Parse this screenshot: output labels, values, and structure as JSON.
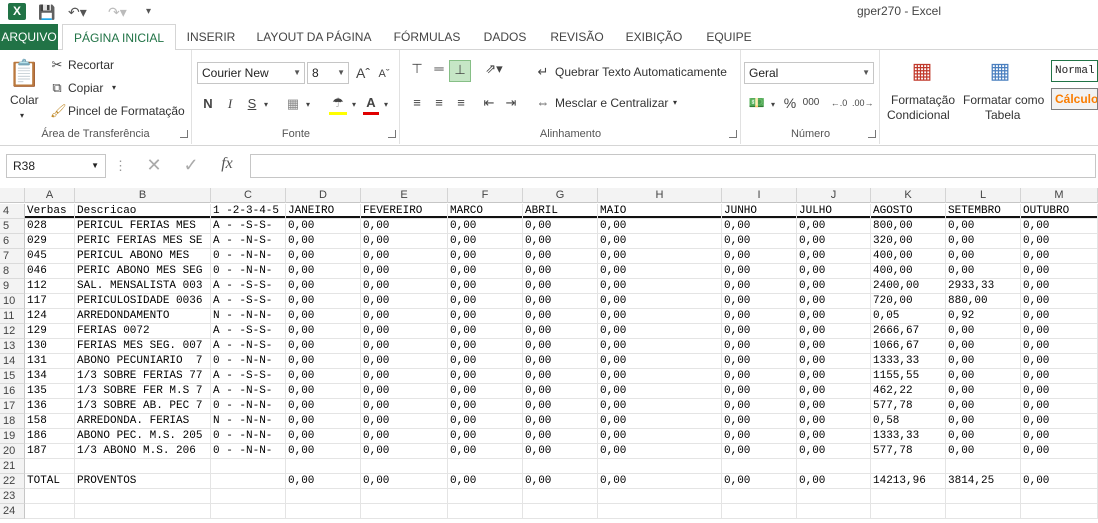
{
  "app": {
    "window_title": "gper270 - Excel"
  },
  "tabs": {
    "file": "ARQUIVO",
    "home": "PÁGINA INICIAL",
    "insert": "INSERIR",
    "layout": "LAYOUT DA PÁGINA",
    "formulas": "FÓRMULAS",
    "data": "DADOS",
    "review": "REVISÃO",
    "view": "EXIBIÇÃO",
    "team": "EQUIPE"
  },
  "ribbon": {
    "clipboard": {
      "label": "Área de Transferência",
      "paste": "Colar",
      "cut": "Recortar",
      "copy": "Copiar",
      "painter": "Pincel de Formatação"
    },
    "font": {
      "label": "Fonte",
      "family": "Courier New",
      "size": "8",
      "bold": "N",
      "italic": "I",
      "underline": "S"
    },
    "alignment": {
      "label": "Alinhamento",
      "wrap": "Quebrar Texto Automaticamente",
      "merge": "Mesclar e Centralizar"
    },
    "number": {
      "label": "Número",
      "format": "Geral",
      "percent": "%",
      "thousands": "000"
    },
    "styles": {
      "conditional_1": "Formatação",
      "conditional_2": "Condicional",
      "table_1": "Formatar como",
      "table_2": "Tabela",
      "normal": "Normal",
      "calc": "Cálculo"
    }
  },
  "formula_bar": {
    "name_box": "R38",
    "fx": "fx",
    "value": ""
  },
  "sheet": {
    "columns": [
      "A",
      "B",
      "C",
      "D",
      "E",
      "F",
      "G",
      "H",
      "I",
      "J",
      "K",
      "L",
      "M"
    ],
    "rows": [
      {
        "n": "4",
        "cells": [
          "Verbas",
          "Descricao",
          "1 -2-3-4-5",
          "JANEIRO",
          "FEVEREIRO",
          "MARCO",
          "ABRIL",
          "MAIO",
          "JUNHO",
          "JULHO",
          "AGOSTO",
          "SETEMBRO",
          "OUTUBRO"
        ]
      },
      {
        "n": "5",
        "cells": [
          "028",
          "PERICUL FERIAS MES",
          "A - -S-S-",
          "0,00",
          "0,00",
          "0,00",
          "0,00",
          "0,00",
          "0,00",
          "0,00",
          "800,00",
          "0,00",
          "0,00"
        ]
      },
      {
        "n": "6",
        "cells": [
          "029",
          "PERIC FERIAS MES SE",
          "A - -N-S-",
          "0,00",
          "0,00",
          "0,00",
          "0,00",
          "0,00",
          "0,00",
          "0,00",
          "320,00",
          "0,00",
          "0,00"
        ]
      },
      {
        "n": "7",
        "cells": [
          "045",
          "PERICUL ABONO MES",
          "0 - -N-N-",
          "0,00",
          "0,00",
          "0,00",
          "0,00",
          "0,00",
          "0,00",
          "0,00",
          "400,00",
          "0,00",
          "0,00"
        ]
      },
      {
        "n": "8",
        "cells": [
          "046",
          "PERIC ABONO MES SEG",
          "0 - -N-N-",
          "0,00",
          "0,00",
          "0,00",
          "0,00",
          "0,00",
          "0,00",
          "0,00",
          "400,00",
          "0,00",
          "0,00"
        ]
      },
      {
        "n": "9",
        "cells": [
          "112",
          "SAL. MENSALISTA 003",
          "A - -S-S-",
          "0,00",
          "0,00",
          "0,00",
          "0,00",
          "0,00",
          "0,00",
          "0,00",
          "2400,00",
          "2933,33",
          "0,00"
        ]
      },
      {
        "n": "10",
        "cells": [
          "117",
          "PERICULOSIDADE 0036",
          "A - -S-S-",
          "0,00",
          "0,00",
          "0,00",
          "0,00",
          "0,00",
          "0,00",
          "0,00",
          "720,00",
          "880,00",
          "0,00"
        ]
      },
      {
        "n": "11",
        "cells": [
          "124",
          "ARREDONDAMENTO",
          "N - -N-N-",
          "0,00",
          "0,00",
          "0,00",
          "0,00",
          "0,00",
          "0,00",
          "0,00",
          "0,05",
          "0,92",
          "0,00"
        ]
      },
      {
        "n": "12",
        "cells": [
          "129",
          "FERIAS 0072",
          "A - -S-S-",
          "0,00",
          "0,00",
          "0,00",
          "0,00",
          "0,00",
          "0,00",
          "0,00",
          "2666,67",
          "0,00",
          "0,00"
        ]
      },
      {
        "n": "13",
        "cells": [
          "130",
          "FERIAS MES SEG. 007",
          "A - -N-S-",
          "0,00",
          "0,00",
          "0,00",
          "0,00",
          "0,00",
          "0,00",
          "0,00",
          "1066,67",
          "0,00",
          "0,00"
        ]
      },
      {
        "n": "14",
        "cells": [
          "131",
          "ABONO PECUNIARIO  7",
          "0 - -N-N-",
          "0,00",
          "0,00",
          "0,00",
          "0,00",
          "0,00",
          "0,00",
          "0,00",
          "1333,33",
          "0,00",
          "0,00"
        ]
      },
      {
        "n": "15",
        "cells": [
          "134",
          "1/3 SOBRE FERIAS 77",
          "A - -S-S-",
          "0,00",
          "0,00",
          "0,00",
          "0,00",
          "0,00",
          "0,00",
          "0,00",
          "1155,55",
          "0,00",
          "0,00"
        ]
      },
      {
        "n": "16",
        "cells": [
          "135",
          "1/3 SOBRE FER M.S 7",
          "A - -N-S-",
          "0,00",
          "0,00",
          "0,00",
          "0,00",
          "0,00",
          "0,00",
          "0,00",
          "462,22",
          "0,00",
          "0,00"
        ]
      },
      {
        "n": "17",
        "cells": [
          "136",
          "1/3 SOBRE AB. PEC 7",
          "0 - -N-N-",
          "0,00",
          "0,00",
          "0,00",
          "0,00",
          "0,00",
          "0,00",
          "0,00",
          "577,78",
          "0,00",
          "0,00"
        ]
      },
      {
        "n": "18",
        "cells": [
          "158",
          "ARREDONDA. FERIAS",
          "N - -N-N-",
          "0,00",
          "0,00",
          "0,00",
          "0,00",
          "0,00",
          "0,00",
          "0,00",
          "0,58",
          "0,00",
          "0,00"
        ]
      },
      {
        "n": "19",
        "cells": [
          "186",
          "ABONO PEC. M.S. 205",
          "0 - -N-N-",
          "0,00",
          "0,00",
          "0,00",
          "0,00",
          "0,00",
          "0,00",
          "0,00",
          "1333,33",
          "0,00",
          "0,00"
        ]
      },
      {
        "n": "20",
        "cells": [
          "187",
          "1/3 ABONO M.S. 206",
          "0 - -N-N-",
          "0,00",
          "0,00",
          "0,00",
          "0,00",
          "0,00",
          "0,00",
          "0,00",
          "577,78",
          "0,00",
          "0,00"
        ]
      },
      {
        "n": "21",
        "cells": [
          "",
          "",
          "",
          "",
          "",
          "",
          "",
          "",
          "",
          "",
          "",
          "",
          ""
        ]
      },
      {
        "n": "22",
        "cells": [
          "TOTAL",
          "PROVENTOS",
          "",
          "0,00",
          "0,00",
          "0,00",
          "0,00",
          "0,00",
          "0,00",
          "0,00",
          "14213,96",
          "3814,25",
          "0,00"
        ]
      },
      {
        "n": "23",
        "cells": [
          "",
          "",
          "",
          "",
          "",
          "",
          "",
          "",
          "",
          "",
          "",
          "",
          ""
        ]
      },
      {
        "n": "24",
        "cells": [
          "",
          "",
          "",
          "",
          "",
          "",
          "",
          "",
          "",
          "",
          "",
          "",
          ""
        ]
      }
    ]
  },
  "colors": {
    "excel_green": "#217346",
    "header_bg": "#f3f3f3"
  }
}
